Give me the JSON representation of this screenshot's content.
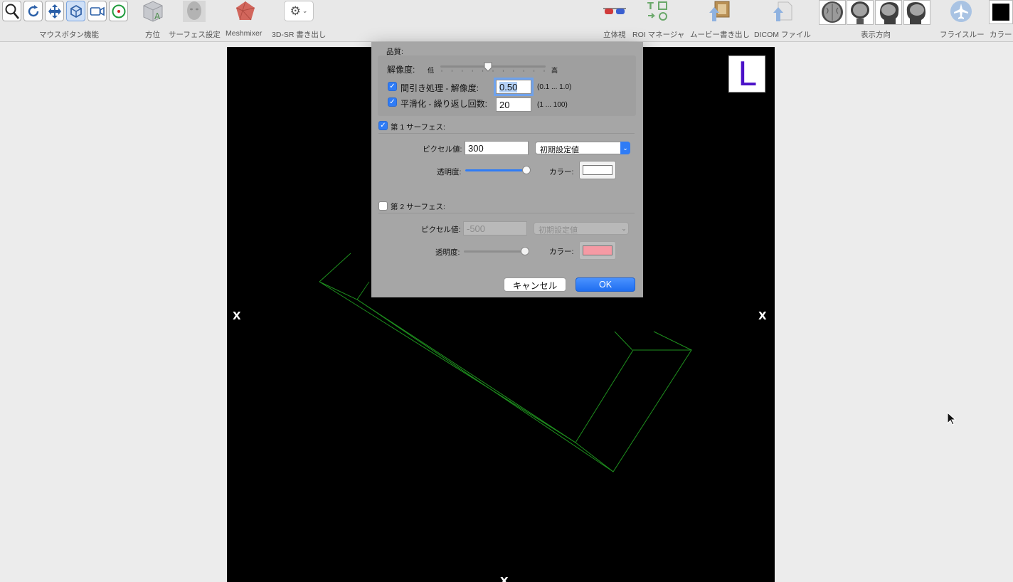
{
  "toolbar": {
    "groups": {
      "mouse_button": "マウスボタン機能",
      "orientation": "方位",
      "surface_settings": "サーフェス設定",
      "meshmixer": "Meshmixer",
      "export_3dsr": "3D-SR 書き出し",
      "stereo": "立体視",
      "roi_manager": "ROI マネージャ",
      "movie_export": "ムービー書き出し",
      "dicom_file": "DICOM ファイル",
      "view_direction": "表示方向",
      "flythrough": "フライスルー",
      "color": "カラー"
    },
    "mouse_buttons": [
      "zoom-icon",
      "rotate-icon",
      "move-icon",
      "3d-rotate-icon",
      "camera-icon",
      "target-icon"
    ],
    "active_mouse_button": "3d-rotate-icon",
    "colors": {
      "accent": "#2f7cf6",
      "color_well": "#000000"
    }
  },
  "viewport": {
    "orientation_marker": "L",
    "edge_markers": {
      "left": "X",
      "right": "X",
      "bottom": "X"
    },
    "wireframe_color": "#1e8f1e",
    "background": "#000000"
  },
  "dialog": {
    "quality_label": "品質:",
    "resolution_label": "解像度:",
    "slider_low": "低",
    "slider_high": "高",
    "resolution_slider_value": 0.45,
    "decimate": {
      "checked": true,
      "label": "間引き処理 - 解像度:",
      "value": "0.50",
      "range": "(0.1 ... 1.0)"
    },
    "smooth": {
      "checked": true,
      "label": "平滑化 - 繰り返し回数:",
      "value": "20",
      "range": "(1 ... 100)"
    },
    "surface1": {
      "checked": true,
      "title": "第 1 サーフェス:",
      "pixel_label": "ピクセル値:",
      "pixel_value": "300",
      "preset": "初期設定値",
      "opacity_label": "透明度:",
      "opacity": 0.95,
      "color_label": "カラー:",
      "color": "#ffffff"
    },
    "surface2": {
      "checked": false,
      "title": "第 2 サーフェス:",
      "pixel_label": "ピクセル値:",
      "pixel_value": "-500",
      "preset": "初期設定値",
      "opacity_label": "透明度:",
      "opacity": 0.95,
      "color_label": "カラー:",
      "color": "#f59aa4"
    },
    "cancel_label": "キャンセル",
    "ok_label": "OK"
  }
}
